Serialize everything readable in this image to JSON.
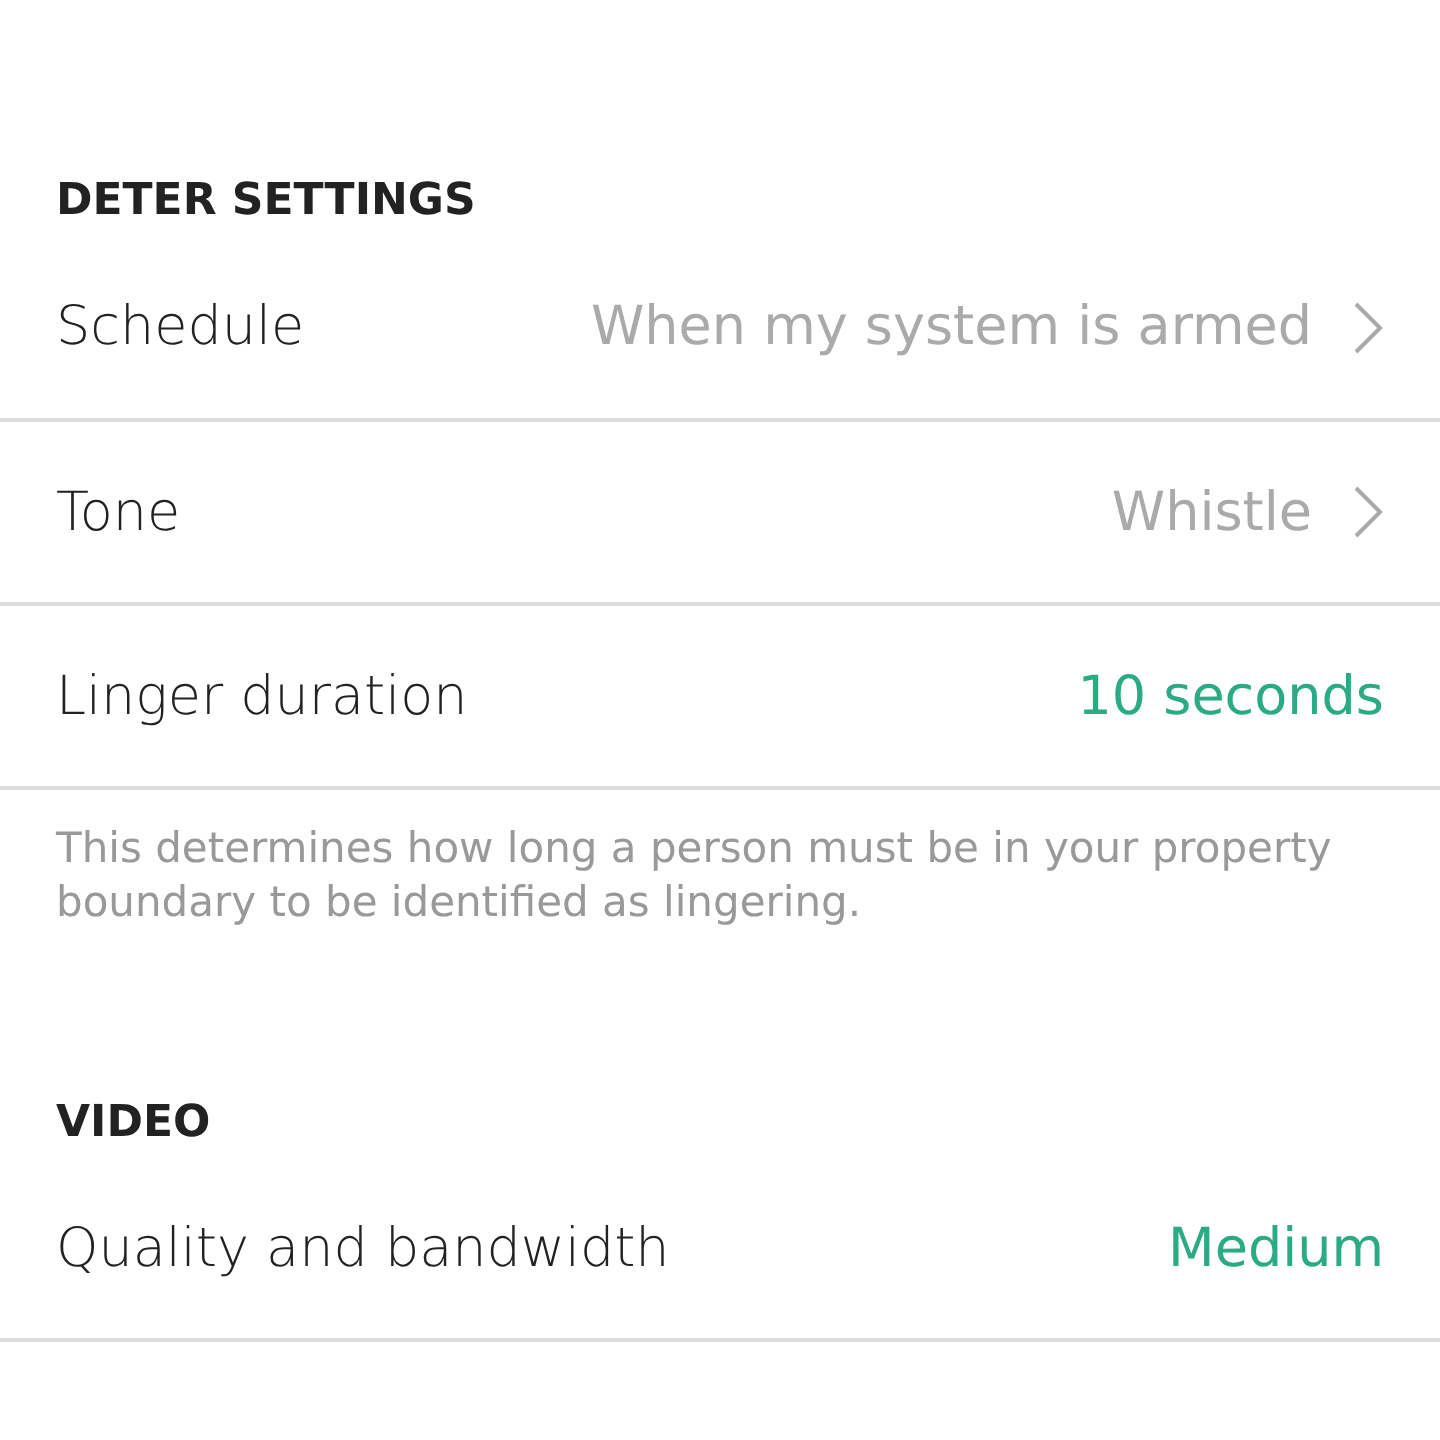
{
  "sections": [
    {
      "title": "DETER SETTINGS",
      "rows": [
        {
          "label": "Schedule",
          "value": "When my system is armed",
          "kind": "nav"
        },
        {
          "label": "Tone",
          "value": "Whistle",
          "kind": "nav"
        },
        {
          "label": "Linger duration",
          "value": "10 seconds",
          "kind": "value"
        }
      ],
      "note": "This determines how long a person must be in your property boundary to be identified as lingering."
    },
    {
      "title": "VIDEO",
      "rows": [
        {
          "label": "Quality and bandwidth",
          "value": "Medium",
          "kind": "value"
        }
      ]
    }
  ]
}
